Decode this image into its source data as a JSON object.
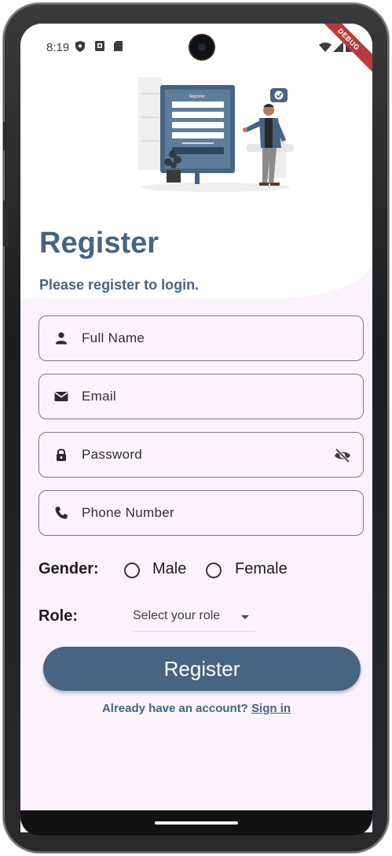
{
  "status_bar": {
    "time": "8:19",
    "debug_ribbon": "DEBUG"
  },
  "header": {
    "title": "Register",
    "subtitle": "Please register to login."
  },
  "form": {
    "full_name": {
      "placeholder": "Full Name",
      "icon": "person-icon"
    },
    "email": {
      "placeholder": "Email",
      "icon": "mail-icon"
    },
    "password": {
      "placeholder": "Password",
      "icon": "lock-icon",
      "trailing_icon": "visibility-off-icon"
    },
    "phone": {
      "placeholder": "Phone Number",
      "icon": "phone-icon"
    },
    "gender": {
      "label": "Gender:",
      "options": [
        "Male",
        "Female"
      ]
    },
    "role": {
      "label": "Role:",
      "placeholder": "Select your role"
    }
  },
  "actions": {
    "register_label": "Register",
    "signin_prompt": "Already have an account?",
    "signin_link": "Sign in"
  },
  "colors": {
    "primary": "#466482",
    "background": "#fbf3fb",
    "border": "#7a7a80"
  }
}
